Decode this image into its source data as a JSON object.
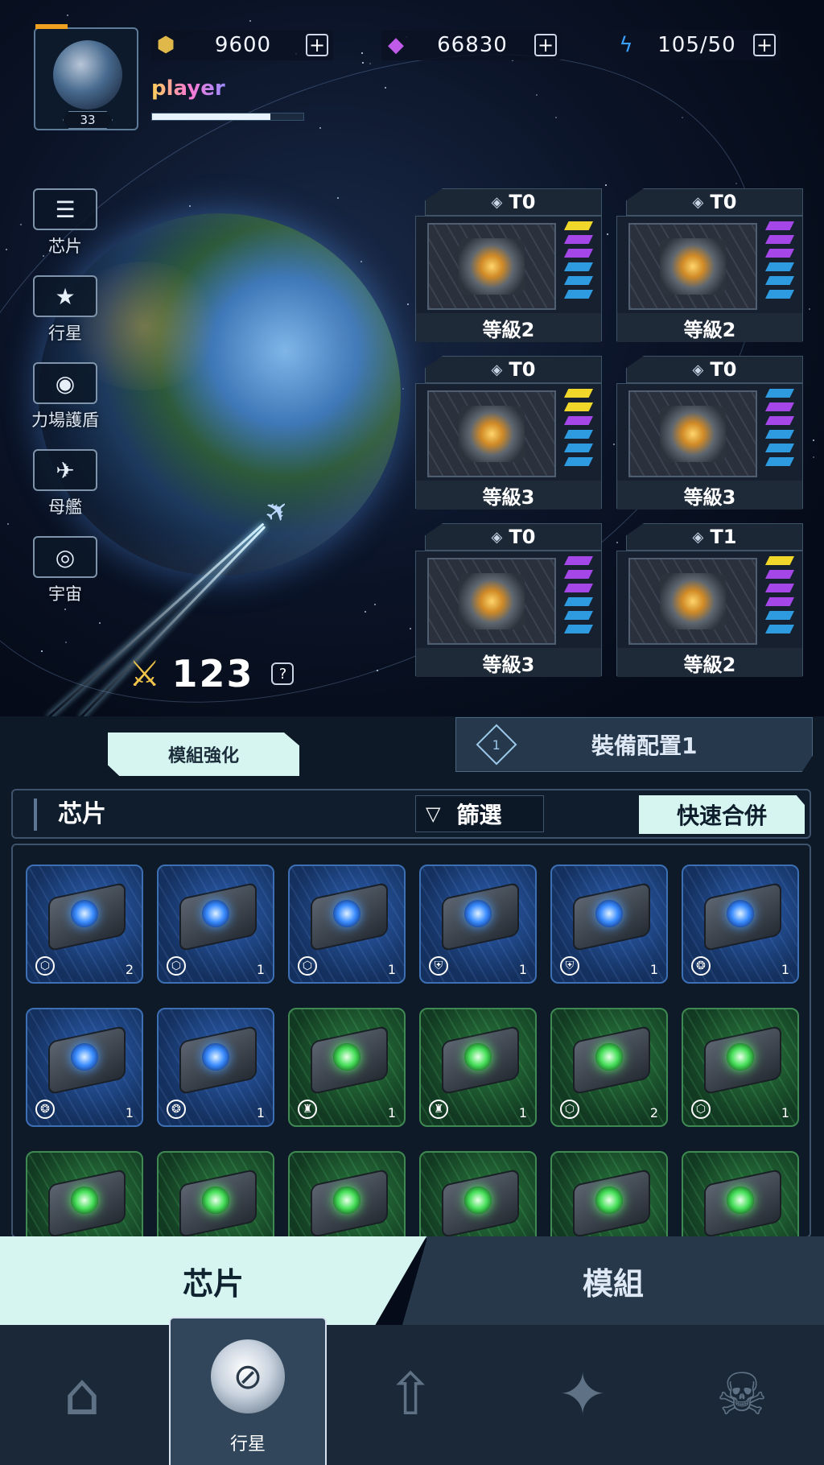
{
  "player": {
    "name": "player",
    "level": "33",
    "xp_fraction": 0.78
  },
  "resources": [
    {
      "name": "gold",
      "value": "9600",
      "icon": "gold-coin-icon",
      "color": "#e0b84a"
    },
    {
      "name": "gems",
      "value": "66830",
      "icon": "gem-icon",
      "color": "#c05ae8"
    },
    {
      "name": "energy",
      "value": "105/50",
      "icon": "lightning-icon",
      "color": "#3aa0ff"
    }
  ],
  "left_menu": [
    {
      "label": "芯片",
      "icon": "list-icon"
    },
    {
      "label": "行星",
      "icon": "rank-icon"
    },
    {
      "label": "力場護盾",
      "icon": "shield-dome-icon"
    },
    {
      "label": "母艦",
      "icon": "mothership-icon"
    },
    {
      "label": "宇宙",
      "icon": "galaxy-icon"
    }
  ],
  "power": {
    "value": "123",
    "help": "?"
  },
  "equipment": [
    {
      "tier": "T0",
      "level": "等級2",
      "bars": [
        "y",
        "p",
        "p",
        "b",
        "b",
        "b"
      ],
      "icon": "turret-icon"
    },
    {
      "tier": "T0",
      "level": "等級2",
      "bars": [
        "p",
        "p",
        "p",
        "b",
        "b",
        "b"
      ],
      "icon": "cube-icon"
    },
    {
      "tier": "T0",
      "level": "等級3",
      "bars": [
        "y",
        "y",
        "p",
        "b",
        "b",
        "b"
      ],
      "icon": "cannon-icon"
    },
    {
      "tier": "T0",
      "level": "等級3",
      "bars": [
        "b",
        "p",
        "p",
        "b",
        "b",
        "b"
      ],
      "icon": "radar-icon"
    },
    {
      "tier": "T0",
      "level": "等級3",
      "bars": [
        "p",
        "p",
        "p",
        "b",
        "b",
        "b"
      ],
      "icon": "core-sphere-icon"
    },
    {
      "tier": "T1",
      "level": "等級2",
      "bars": [
        "y",
        "p",
        "p",
        "p",
        "b",
        "b"
      ],
      "icon": "reactor-icon"
    }
  ],
  "tabs": {
    "module_upgrade": "模組強化",
    "loadout_num": "1",
    "loadout": "裝備配置1"
  },
  "filter_bar": {
    "title": "芯片",
    "filter": "篩選",
    "quick_merge": "快速合併"
  },
  "chips": [
    {
      "color": "blue",
      "icon": "cube",
      "count": "2"
    },
    {
      "color": "blue",
      "icon": "cube",
      "count": "1"
    },
    {
      "color": "blue",
      "icon": "cube",
      "count": "1"
    },
    {
      "color": "blue",
      "icon": "shield",
      "count": "1"
    },
    {
      "color": "blue",
      "icon": "shield",
      "count": "1"
    },
    {
      "color": "blue",
      "icon": "ring",
      "count": "1"
    },
    {
      "color": "blue",
      "icon": "ring",
      "count": "1"
    },
    {
      "color": "blue",
      "icon": "ring",
      "count": "1"
    },
    {
      "color": "green",
      "icon": "turret",
      "count": "1"
    },
    {
      "color": "green",
      "icon": "turret",
      "count": "1"
    },
    {
      "color": "green",
      "icon": "cube",
      "count": "2"
    },
    {
      "color": "green",
      "icon": "cube",
      "count": "1"
    },
    {
      "color": "green",
      "icon": "",
      "count": ""
    },
    {
      "color": "green",
      "icon": "",
      "count": ""
    },
    {
      "color": "green",
      "icon": "",
      "count": ""
    },
    {
      "color": "green",
      "icon": "",
      "count": ""
    },
    {
      "color": "green",
      "icon": "",
      "count": ""
    },
    {
      "color": "green",
      "icon": "",
      "count": ""
    }
  ],
  "category_tabs": {
    "chips": "芯片",
    "modules": "模組"
  },
  "bottom_nav": {
    "active_label": "行星",
    "items": [
      "shop-icon",
      "planet-icon",
      "fleet-icon",
      "satellite-icon",
      "skull-icon"
    ]
  }
}
